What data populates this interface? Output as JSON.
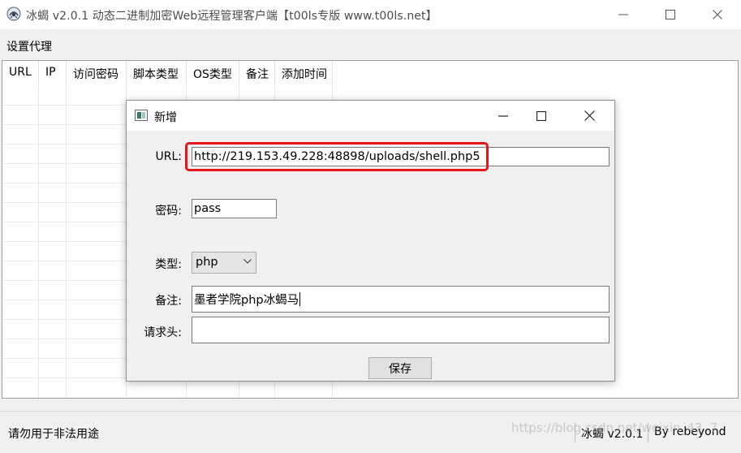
{
  "window": {
    "title": "冰蝎 v2.0.1 动态二进制加密Web远程管理客户端【t00ls专版 www.t00ls.net】",
    "icon": "scorpion-logo-icon"
  },
  "menu": {
    "items": [
      {
        "label": "设置代理"
      }
    ]
  },
  "table": {
    "columns": [
      {
        "label": "URL"
      },
      {
        "label": "IP"
      },
      {
        "label": "访问密码"
      },
      {
        "label": "脚本类型"
      },
      {
        "label": "OS类型"
      },
      {
        "label": "备注"
      },
      {
        "label": "添加时间"
      }
    ],
    "rows": []
  },
  "status": {
    "notice": "请勿用于非法用途",
    "version": "冰蝎 v2.0.1",
    "author": "By rebeyond"
  },
  "watermark": "https://blog.csdn.net/weixin_43..7",
  "dialog": {
    "title": "新增",
    "url_label": "URL:",
    "url_value": "http://219.153.49.228:48898/uploads/shell.php5",
    "password_label": "密码:",
    "password_value": "pass",
    "type_label": "类型:",
    "type_value": "php",
    "note_label": "备注:",
    "note_value": "墨者学院php冰蝎马",
    "headers_label": "请求头:",
    "headers_value": "",
    "save_label": "保存"
  },
  "colors": {
    "highlight": "#e8161b",
    "titlebar": "#ffffff",
    "window_bg": "#f0f0f0"
  }
}
